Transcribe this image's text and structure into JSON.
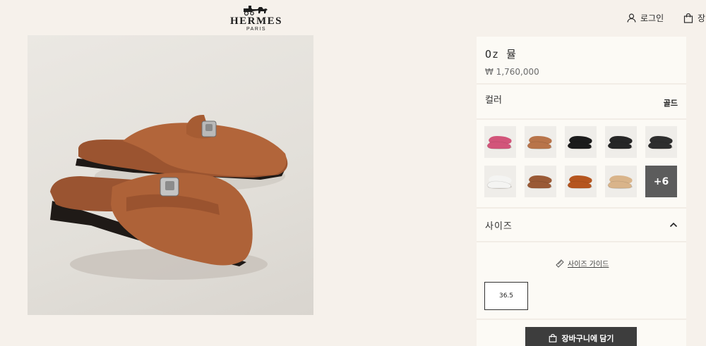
{
  "header": {
    "brand": "HERMES",
    "city": "PARIS",
    "login_label": "로그인",
    "cart_label": "장"
  },
  "product": {
    "image_alt": "brown leather mules with silver kelly clasp",
    "title": "Oz 뮬",
    "price": "₩ 1,760,000"
  },
  "color": {
    "label": "컬러",
    "selected_value": "골드",
    "swatches": [
      {
        "name": "pink",
        "color": "#d2557a"
      },
      {
        "name": "tan",
        "color": "#b8744a"
      },
      {
        "name": "black",
        "color": "#1b1b1b"
      },
      {
        "name": "black-2",
        "color": "#262626"
      },
      {
        "name": "black-3",
        "color": "#2e2e2e"
      },
      {
        "name": "white",
        "color": "#f4f4f2"
      },
      {
        "name": "gold",
        "color": "#9a5a36"
      },
      {
        "name": "orange-brown",
        "color": "#b5551e"
      },
      {
        "name": "cream",
        "color": "#d9b48a"
      }
    ],
    "more_label": "+6"
  },
  "size": {
    "label": "사이즈",
    "guide_label": "사이즈 가이드",
    "option": "36.5"
  },
  "cart": {
    "button_label": "장바구니에 담기"
  }
}
